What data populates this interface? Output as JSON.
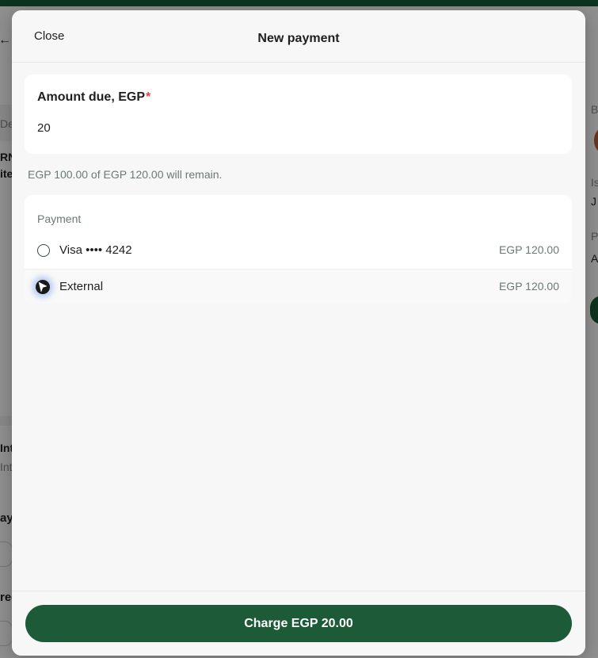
{
  "modal": {
    "close_label": "Close",
    "title": "New payment",
    "amount": {
      "label": "Amount due, EGP",
      "required_marker": "*",
      "value": "20"
    },
    "remaining_note": "EGP 100.00 of EGP 120.00 will remain.",
    "payment": {
      "heading": "Payment",
      "methods": [
        {
          "label": "Visa •••• 4242",
          "amount": "EGP 120.00",
          "selected": false
        },
        {
          "label": "External",
          "amount": "EGP 120.00",
          "selected": true
        }
      ]
    },
    "charge_label": "Charge EGP 20.00"
  },
  "background": {
    "fragments": [
      "De",
      "RN",
      "ite",
      "Int",
      "Int",
      "ayr",
      "rec",
      "B",
      "Is",
      "J",
      "P",
      "A"
    ]
  },
  "colors": {
    "brand_green": "#1c5a38",
    "required_red": "#e0443e",
    "muted_text": "#6b7a72",
    "modal_bg": "#f7f7f7"
  }
}
